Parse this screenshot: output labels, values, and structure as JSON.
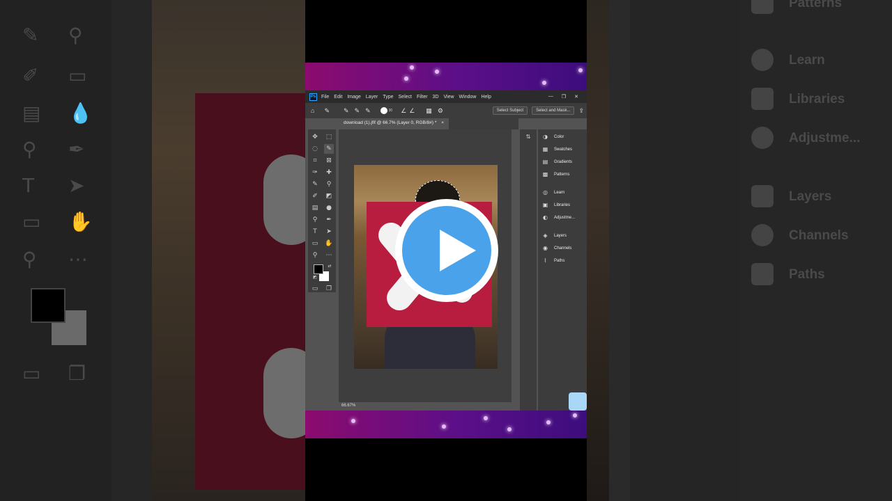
{
  "window": {
    "app_logo": "Ps",
    "menu": [
      "File",
      "Edit",
      "Image",
      "Layer",
      "Type",
      "Select",
      "Filter",
      "3D",
      "View",
      "Window",
      "Help"
    ],
    "controls": [
      "—",
      "❐",
      "✕"
    ]
  },
  "options_bar": {
    "brush_size": "30",
    "select_subject": "Select Subject",
    "select_and_mask": "Select and Mask..."
  },
  "document": {
    "tab_title": "download (1).jfif @ 66.7% (Layer 0, RGB/8#) *",
    "zoom_status": "66.67%"
  },
  "panels": {
    "items": [
      {
        "label": "Color",
        "icon": "color-icon"
      },
      {
        "label": "Swatches",
        "icon": "swatches-icon"
      },
      {
        "label": "Gradients",
        "icon": "gradients-icon"
      },
      {
        "label": "Patterns",
        "icon": "patterns-icon"
      },
      {
        "label": "Learn",
        "icon": "learn-icon"
      },
      {
        "label": "Libraries",
        "icon": "libraries-icon"
      },
      {
        "label": "Adjustme...",
        "icon": "adjustments-icon"
      },
      {
        "label": "Layers",
        "icon": "layers-icon"
      },
      {
        "label": "Channels",
        "icon": "channels-icon"
      },
      {
        "label": "Paths",
        "icon": "paths-icon"
      }
    ]
  },
  "background_right": {
    "items": [
      "Patterns",
      "Learn",
      "Libraries",
      "Adjustme...",
      "Layers",
      "Channels",
      "Paths"
    ]
  },
  "colors": {
    "accent_play": "#4aa3ea",
    "logo_red": "#b81c3e",
    "band_purple": "#5b0f88"
  }
}
